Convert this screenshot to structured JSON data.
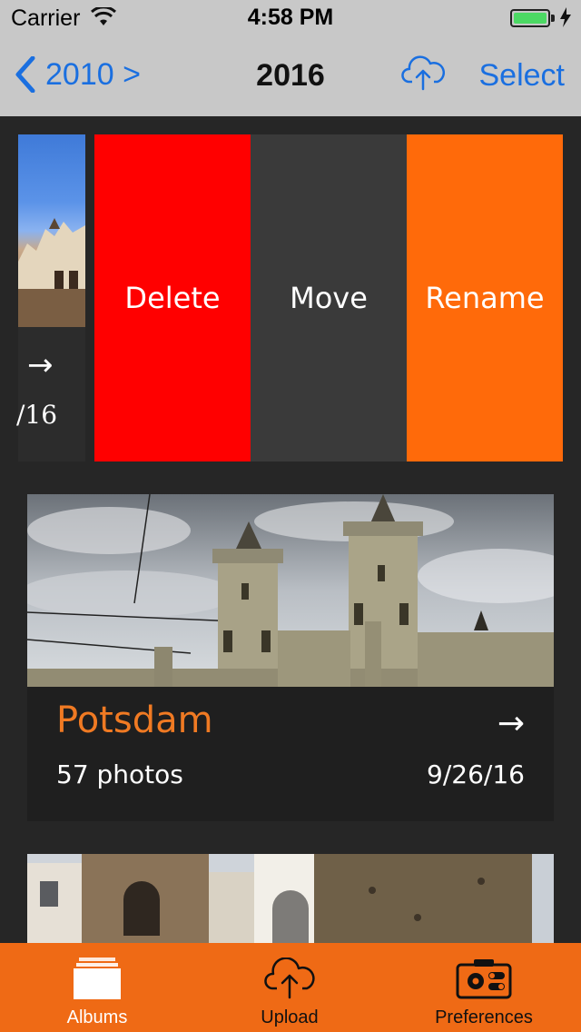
{
  "status_bar": {
    "carrier": "Carrier",
    "time": "4:58 PM",
    "wifi_icon": "wifi-icon",
    "battery_icon": "battery-icon",
    "battery_level": 1.0
  },
  "nav": {
    "back_label": "2010 >",
    "title": "2016",
    "upload_icon": "cloud-upload-icon",
    "select_label": "Select"
  },
  "album_partial": {
    "date": "/16"
  },
  "swipe_actions": {
    "delete": "Delete",
    "move": "Move",
    "rename": "Rename"
  },
  "albums": [
    {
      "title": "Potsdam",
      "count": "57 photos",
      "date": "9/26/16"
    }
  ],
  "tab_bar": {
    "tabs": [
      {
        "label": "Albums",
        "icon": "albums-icon",
        "selected": true
      },
      {
        "label": "Upload",
        "icon": "cloud-upload-icon",
        "selected": false
      },
      {
        "label": "Preferences",
        "icon": "preferences-icon",
        "selected": false
      }
    ]
  },
  "colors": {
    "accent_orange": "#ef6a15",
    "delete_red": "#ff0000",
    "nav_blue": "#1a6fe0",
    "title_orange": "#f07a23"
  }
}
